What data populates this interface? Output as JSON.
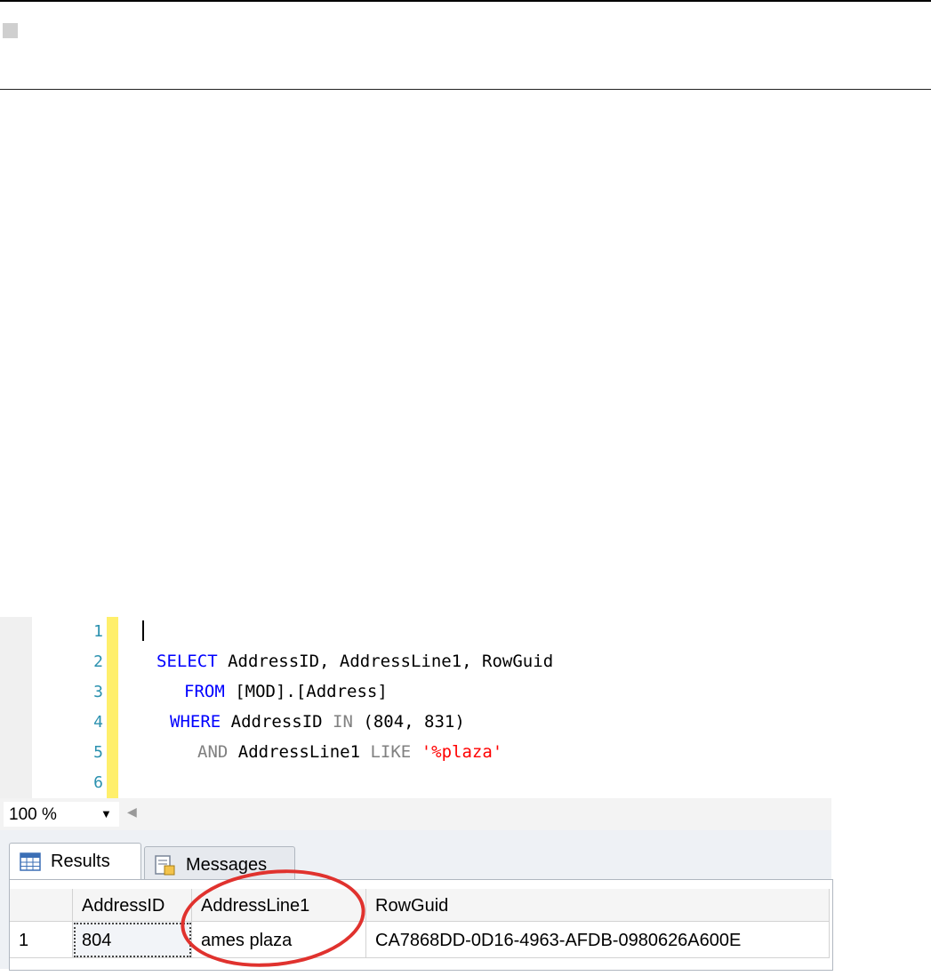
{
  "editor": {
    "line_numbers": [
      "1",
      "2",
      "3",
      "4",
      "5",
      "6"
    ],
    "line2": {
      "kw": "SELECT",
      "rest": " AddressID, AddressLine1, RowGuid"
    },
    "line3": {
      "kw": "FROM",
      "rest": " [MOD].[Address]"
    },
    "line4": {
      "kw": "WHERE",
      "col": " AddressID ",
      "op": "IN",
      "rest": " (804, 831)"
    },
    "line5": {
      "op1": "AND",
      "col": " AddressLine1 ",
      "op2": "LIKE",
      "str": " '%plaza'"
    }
  },
  "zoom": {
    "value": "100 %"
  },
  "tabs": {
    "results": "Results",
    "messages": "Messages"
  },
  "grid": {
    "headers": [
      "",
      "AddressID",
      "AddressLine1",
      "RowGuid"
    ],
    "rows": [
      {
        "num": "1",
        "AddressID": "804",
        "AddressLine1": "ames plaza",
        "RowGuid": "CA7868DD-0D16-4963-AFDB-0980626A600E"
      }
    ]
  },
  "colors": {
    "keyword": "#0000ff",
    "operator": "#808080",
    "string": "#ff0000",
    "line_number": "#2b91af",
    "highlight_circle": "#e0322e"
  }
}
